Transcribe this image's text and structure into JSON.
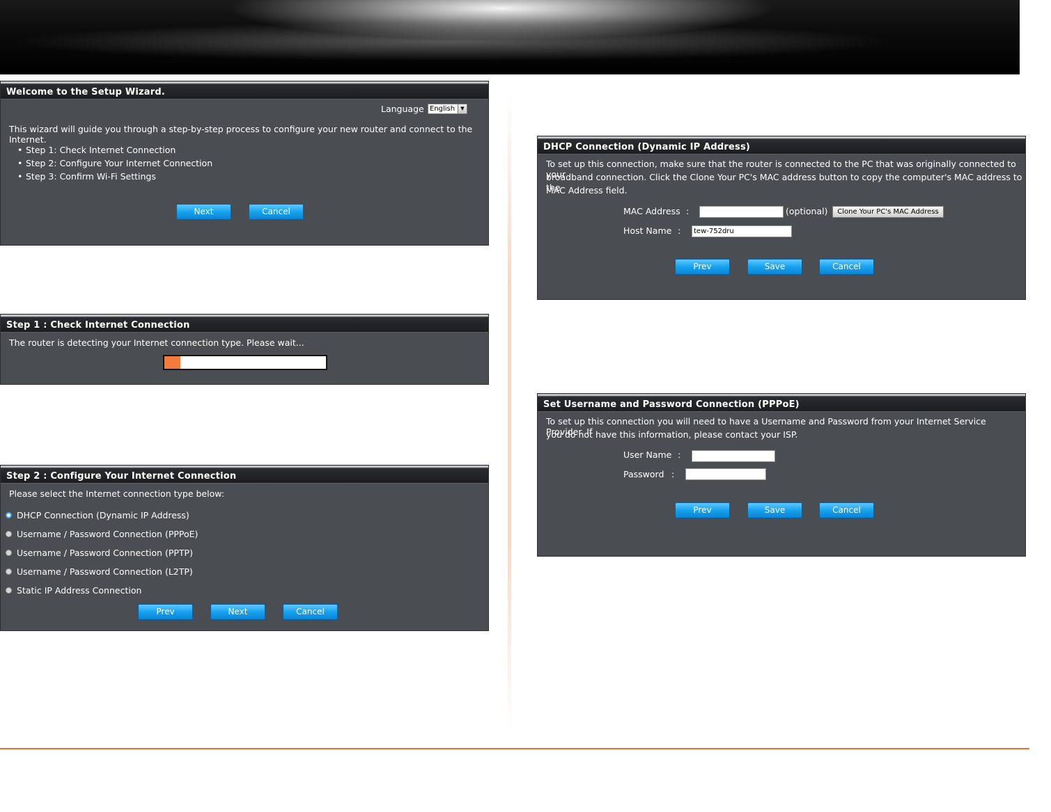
{
  "welcome": {
    "title": "Welcome to the Setup Wizard.",
    "language_label": "Language :",
    "language_value": "English",
    "intro": "This wizard will guide you through a step-by-step process to configure your new router and connect to the Internet.",
    "steps": [
      "Step 1: Check Internet Connection",
      "Step 2: Configure Your Internet Connection",
      "Step 3: Confirm Wi-Fi Settings"
    ],
    "next_label": "Next",
    "cancel_label": "Cancel"
  },
  "step1": {
    "title": "Step 1 : Check Internet Connection",
    "message": "The router is detecting your Internet connection type. Please wait...",
    "progress": 0.1,
    "progress_color": "#f47b3e"
  },
  "step2": {
    "title": "Step 2 : Configure Your Internet Connection",
    "prompt": "Please select the Internet connection type below:",
    "options": [
      "DHCP Connection (Dynamic IP Address)",
      "Username / Password Connection (PPPoE)",
      "Username / Password Connection (PPTP)",
      "Username / Password Connection (L2TP)",
      "Static IP Address Connection"
    ],
    "selected_index": 0,
    "prev_label": "Prev",
    "next_label": "Next",
    "cancel_label": "Cancel"
  },
  "dhcp": {
    "title": "DHCP Connection (Dynamic IP Address)",
    "desc_line1": "To set up this connection, make sure that the router is connected to the PC that was originally connected to your",
    "desc_line2": "broadband connection. Click the Clone Your PC's MAC address button to copy the computer's MAC address to the",
    "desc_line3": "MAC Address field.",
    "mac_label": "MAC Address",
    "colon": ":",
    "mac_value": "",
    "optional": "(optional)",
    "clone_label": "Clone Your PC's MAC Address",
    "host_label": "Host Name",
    "host_value": "tew-752dru",
    "prev_label": "Prev",
    "save_label": "Save",
    "cancel_label": "Cancel"
  },
  "pppoe": {
    "title": "Set Username and Password Connection (PPPoE)",
    "desc_line1": "To set up this connection you will need to have a Username and Password from your Internet Service Provider. If",
    "desc_line2": "you do not have this information, please contact your ISP.",
    "user_label": "User Name",
    "password_label": "Password",
    "colon": ":",
    "user_value": "",
    "password_value": "",
    "prev_label": "Prev",
    "save_label": "Save",
    "cancel_label": "Cancel"
  },
  "colors": {
    "panel_bg": "#4a4d52",
    "button_blue": "#17a2ee",
    "accent_orange": "#e8722c"
  }
}
